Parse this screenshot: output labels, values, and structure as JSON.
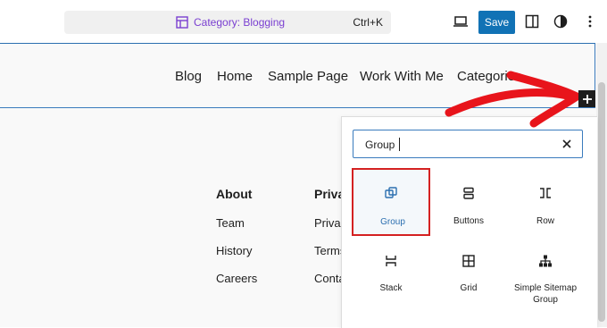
{
  "toolbar": {
    "document_title": "Category: Blogging",
    "shortcut": "Ctrl+K",
    "save_label": "Save",
    "icons": [
      "desktop-preview-icon",
      "sidebar-toggle-icon",
      "styles-contrast-icon",
      "more-options-icon"
    ]
  },
  "header": {
    "nav_items": [
      "Blog",
      "Home",
      "Sample Page",
      "Work With Me",
      "Categories"
    ]
  },
  "footer": {
    "columns": [
      {
        "heading": "About",
        "links": [
          "Team",
          "History",
          "Careers"
        ]
      },
      {
        "heading": "Priva",
        "links": [
          "Privac",
          "Terms",
          "Conta"
        ]
      }
    ]
  },
  "inserter": {
    "search_value": "Group",
    "blocks": [
      {
        "label": "Group",
        "icon": "group-icon",
        "selected": true
      },
      {
        "label": "Buttons",
        "icon": "buttons-icon",
        "selected": false
      },
      {
        "label": "Row",
        "icon": "row-icon",
        "selected": false
      },
      {
        "label": "Stack",
        "icon": "stack-icon",
        "selected": false
      },
      {
        "label": "Grid",
        "icon": "grid-icon",
        "selected": false
      },
      {
        "label": "Simple Sitemap Group",
        "icon": "sitemap-icon",
        "selected": false
      }
    ]
  },
  "colors": {
    "accent": "#1172b5",
    "title_purple": "#7a3fd1",
    "highlight_red": "#d42121",
    "annotation_arrow": "#e8141b"
  }
}
